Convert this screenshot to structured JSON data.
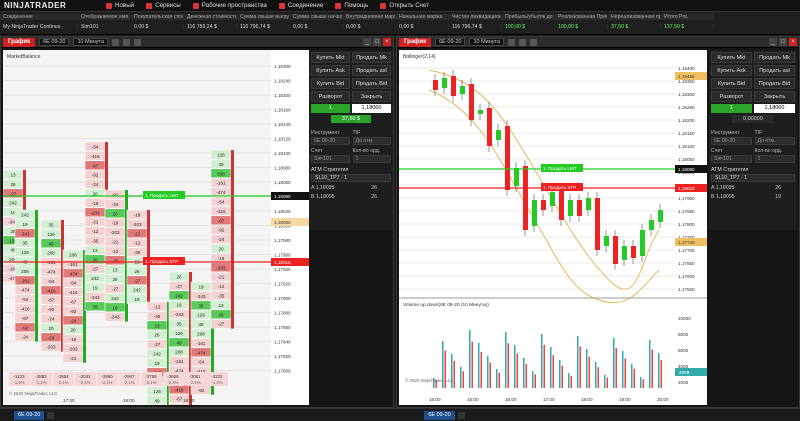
{
  "app": {
    "logo": "NINJATRADER",
    "menu": [
      {
        "label": "Новый",
        "icon": "new-icon"
      },
      {
        "label": "Сервисы",
        "icon": "tools-icon"
      },
      {
        "label": "Рабочие пространства",
        "icon": "workspace-icon"
      },
      {
        "label": "Соединение",
        "icon": "connection-icon"
      },
      {
        "label": "Помощь",
        "icon": "help-icon"
      },
      {
        "label": "Открыть Счет",
        "icon": "account-icon"
      }
    ]
  },
  "accounts": {
    "headers": [
      "Соединение",
      "Отображаемое имя",
      "Покупательская способ",
      "Денежная стоимость",
      "Сумма свыше выгрузки",
      "Сумма свыше начальн",
      "Внутридневная маржа",
      "Начальная маржа",
      "Чистая ликвидационная",
      "Прибыль/убыток до вы",
      "Реализованная Прибы",
      "Нереализованная приб",
      "Итого PnL"
    ],
    "row": [
      "My NinjaTrader Continuu",
      "Sim101",
      "0,00 $",
      "116 759,24 $",
      "116 796,74 $",
      "0,00 $",
      "0,00 $",
      "0,00 $",
      "116 796,74 $",
      "100,00 $",
      "100,00 $",
      "37,50 $",
      "137,50 $"
    ]
  },
  "left_window": {
    "title": "График",
    "instrument": "6E 09-20",
    "interval": "10 Минута",
    "chart_label": "MarketBalance",
    "prices": [
      "1,18300",
      "1,18240",
      "1,18200",
      "1,18160",
      "1,18140",
      "1,18120",
      "1,18100",
      "1,18080",
      "1,18060",
      "1,18040",
      "1,18020",
      "1,18000",
      "1,17980",
      "1,17960",
      "1,17940",
      "1,17920",
      "1,17900",
      "1,17880",
      "1,17860",
      "1,17840",
      "1,17820",
      "1,17800"
    ],
    "times": [
      "17:30",
      "18:00",
      "18:30"
    ],
    "footer_vals": [
      "-1423",
      "-2883",
      "-1954",
      "-2041",
      "-2860",
      "-2947",
      "-3758",
      "-3656",
      "-3061",
      "-2221"
    ],
    "footer_pct": [
      "-1,5%",
      "-1,2%",
      "-2,1%",
      "-2,1%",
      "-2,1%",
      "-2,1%",
      "-2,1%",
      "-2,3%",
      "-2,5%",
      "-1,4%"
    ],
    "copyright": "© 2020 NinjaTrader, LLC",
    "order_lmt": "1. Продать LMT",
    "order_stp": "1. Продать STP",
    "price_lmt": "1,18090",
    "price_stp": "1,18010",
    "price_mid": "1,18060",
    "qty": "37,50 $"
  },
  "right_window": {
    "title": "График",
    "instrument": "6E 09-20",
    "interval": "10 Минута",
    "chart_label": "Bollinger(2,14)",
    "prices": [
      "1,18400",
      "1,18350",
      "1,18300",
      "1,18250",
      "1,18200",
      "1,18150",
      "1,18100",
      "1,18050",
      "1,18000",
      "1,17950",
      "1,17900",
      "1,17850",
      "1,17800",
      "1,17750",
      "1,17700",
      "1,17650",
      "1,17600",
      "1,17550"
    ],
    "vol_label": "Volume up down(6E 09-20 (10 Минута))",
    "vol_ticks": [
      "10000",
      "8000",
      "6000",
      "4000",
      "2000"
    ],
    "vol_last": "2589",
    "times": [
      "16:00",
      "15:00",
      "16:00",
      "17:00",
      "18:00",
      "19:00",
      "20:00"
    ],
    "price_top": "1,18455",
    "price_lmt": "1,18090",
    "price_stp": "1,18010",
    "price_low": "1,17740",
    "order_lmt": "1. Продать LMT",
    "order_stp": "1. Продать STP",
    "copyright": "© 2020 NinjaTrader, LLC"
  },
  "left_panel": {
    "buy_mkt": "Купить Mkt",
    "sell_mkt": "Продать Mk",
    "buy_ask": "Купить Ask",
    "sell_ask": "Продать asl",
    "buy_bid": "Купить Bid",
    "sell_bid": "Продать Bid",
    "reverse": "Разворот",
    "close": "Закрыть",
    "qty": "1",
    "price": "1,18060",
    "pnl": "37,50 $",
    "instrument_label": "Инструмент",
    "instrument": "6E 09-20",
    "tif_label": "TIF",
    "tif": "До отм.",
    "account_label": "Счет",
    "account": "Sim101",
    "qty_label": "Кол-во орд.",
    "qty_val": "1",
    "atm_label": "ATM Стратегия",
    "atm": "SL10_TP7 - 1",
    "a_label": "A  1,18095",
    "a_val": "26",
    "b_label": "B  1,18095",
    "b_val": "26"
  },
  "right_panel": {
    "buy_mkt": "Купить Mkt",
    "sell_mkt": "Продать Mk",
    "buy_ask": "Купить Ask",
    "sell_ask": "Продать asl",
    "buy_bid": "Купить Bid",
    "sell_bid": "Продать Bid",
    "reverse": "Разворот",
    "close": "Закрыть",
    "qty": "1",
    "price": "1,18060",
    "pnl": "0,00000",
    "instrument_label": "Инструмент",
    "instrument": "6E 09-20",
    "tif_label": "TIF",
    "tif": "До отм.",
    "account_label": "Счет",
    "account": "Sim101",
    "qty_label": "Кол-во орд.",
    "qty_val": "1",
    "atm_label": "ATM Стратегия",
    "atm": "SL10_TP7 - 1",
    "a_label": "A  1,18095",
    "a_val": "26",
    "b_label": "B  1,18095",
    "b_val": "19"
  },
  "status": {
    "left_tab": "6E 09-20",
    "right_tab": "6E 09-20"
  }
}
